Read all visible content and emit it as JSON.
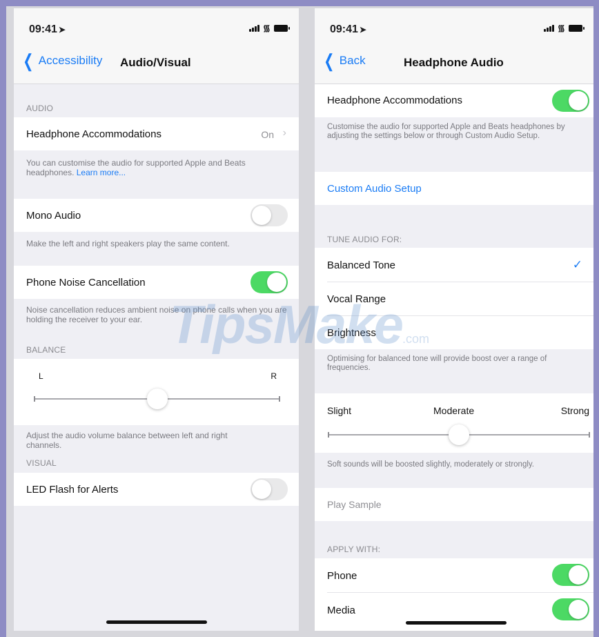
{
  "left": {
    "status": {
      "time": "09:41"
    },
    "nav": {
      "back_label": "Accessibility",
      "title": "Audio/Visual"
    },
    "audio_header": "AUDIO",
    "headphone": {
      "label": "Headphone Accommodations",
      "value": "On"
    },
    "headphone_footer": "You can customise the audio for supported Apple and Beats headphones.",
    "learn_more": "Learn more...",
    "mono": {
      "label": "Mono Audio",
      "on": false
    },
    "mono_footer": "Make the left and right speakers play the same content.",
    "noise": {
      "label": "Phone Noise Cancellation",
      "on": true
    },
    "noise_footer": "Noise cancellation reduces ambient noise on phone calls when you are holding the receiver to your ear.",
    "balance_header": "BALANCE",
    "balance": {
      "left_label": "L",
      "right_label": "R",
      "value": 0.5
    },
    "balance_footer": "Adjust the audio volume balance between left and right channels.",
    "visual_header": "VISUAL",
    "led": {
      "label": "LED Flash for Alerts",
      "on": false
    }
  },
  "right": {
    "status": {
      "time": "09:41"
    },
    "nav": {
      "back_label": "Back",
      "title": "Headphone Audio"
    },
    "accommodations": {
      "label": "Headphone Accommodations",
      "on": true
    },
    "accommodations_footer": "Customise the audio for supported Apple and Beats headphones by adjusting the settings below or through Custom Audio Setup.",
    "custom_setup": "Custom Audio Setup",
    "tune_header": "TUNE AUDIO FOR:",
    "tune_options": [
      {
        "label": "Balanced Tone",
        "selected": true
      },
      {
        "label": "Vocal Range",
        "selected": false
      },
      {
        "label": "Brightness",
        "selected": false
      }
    ],
    "tune_footer": "Optimising for balanced tone will provide boost over a range of frequencies.",
    "boost": {
      "slight": "Slight",
      "moderate": "Moderate",
      "strong": "Strong",
      "value": 0.5
    },
    "boost_footer": "Soft sounds will be boosted slightly, moderately or strongly.",
    "play_sample": "Play Sample",
    "apply_header": "APPLY WITH:",
    "apply": [
      {
        "label": "Phone",
        "on": true
      },
      {
        "label": "Media",
        "on": true
      }
    ]
  },
  "watermark": {
    "text": "TipsMake",
    "suffix": ".com"
  },
  "colors": {
    "accent": "#1a7cf5",
    "toggle_on": "#4cd964",
    "background": "#efeff4",
    "frame": "#8e8cc4"
  }
}
